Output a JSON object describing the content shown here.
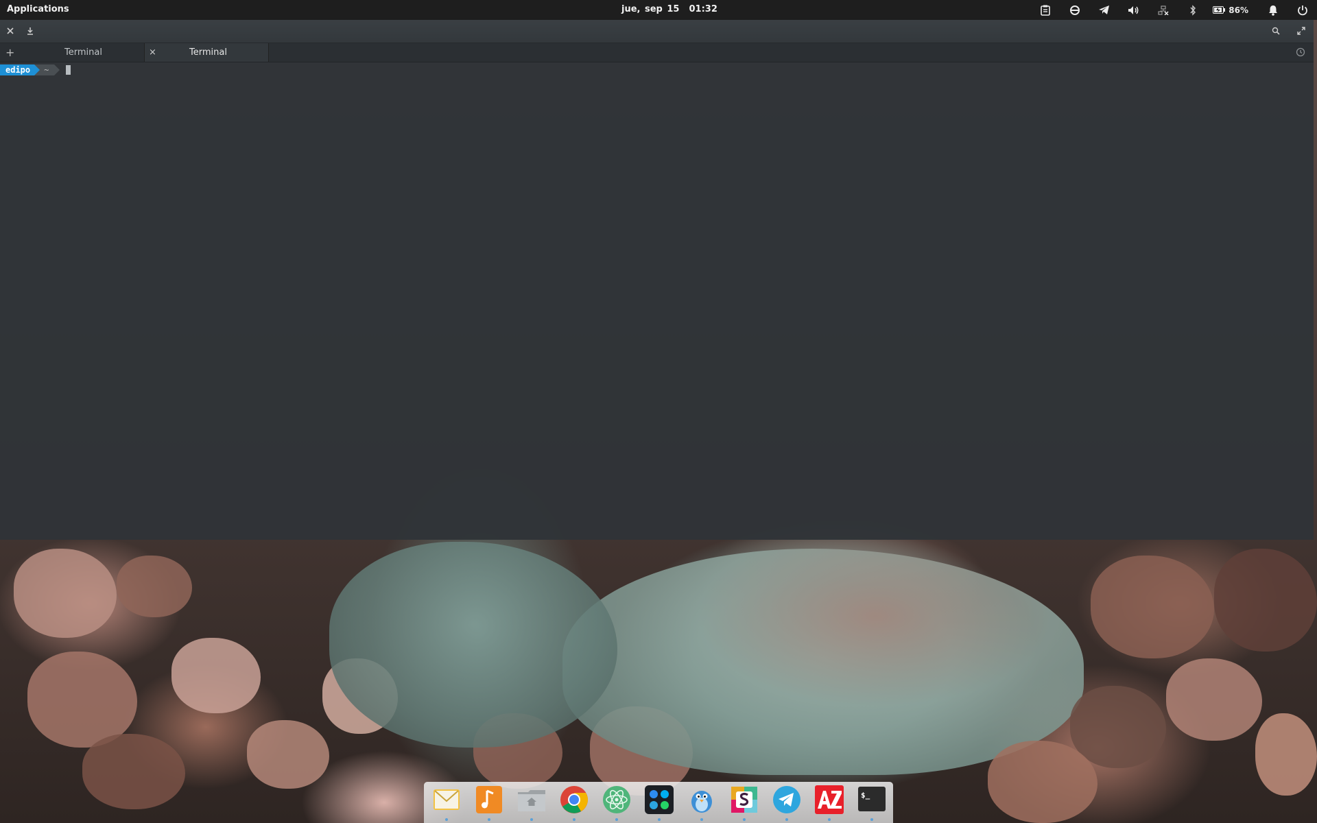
{
  "top_panel": {
    "applications_label": "Applications",
    "date": "jue, sep 15",
    "time": "01:32",
    "battery_percent": "86%",
    "indicators": [
      "clipboard-icon",
      "sync-icon",
      "telegram-icon",
      "volume-icon",
      "network-icon",
      "bluetooth-icon",
      "battery-icon",
      "notifications-icon",
      "power-icon"
    ]
  },
  "terminal": {
    "toolbar_icons": [
      "close-icon",
      "download-icon",
      "search-icon",
      "fullscreen-icon"
    ],
    "tabs": [
      {
        "label": "Terminal",
        "active": false
      },
      {
        "label": "Terminal",
        "active": true
      }
    ],
    "new_tab_symbol": "+",
    "close_symbol": "×",
    "prompt": {
      "user": "edipo",
      "dir": "~"
    }
  },
  "dock": {
    "items": [
      "mail",
      "music",
      "files",
      "chrome",
      "atom",
      "messenger-hub",
      "bird-client",
      "slack",
      "telegram",
      "az-app",
      "terminal"
    ]
  },
  "colors": {
    "panel": "#1e1e1e",
    "terminal_bg": "#2f3438",
    "prompt_user": "#1e90d6",
    "prompt_dir": "#4a4f53"
  }
}
